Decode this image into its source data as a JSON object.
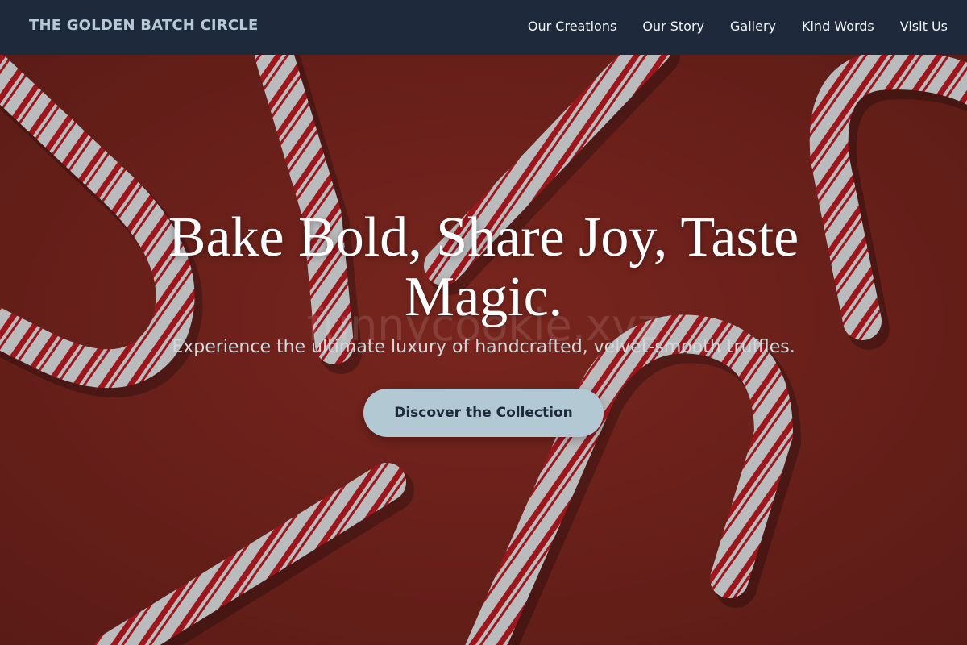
{
  "nav": {
    "brand": "THE GOLDEN BATCH CIRCLE",
    "links": [
      "Our Creations",
      "Our Story",
      "Gallery",
      "Kind Words",
      "Visit Us"
    ]
  },
  "hero": {
    "title": "Bake Bold, Share Joy, Taste Magic.",
    "subtitle": "Experience the ultimate luxury of handcrafted, velvet-smooth truffles.",
    "cta_label": "Discover the Collection",
    "watermark": "funnycookie.xyz",
    "background_image": "candy-canes-on-red"
  },
  "colors": {
    "nav_bg": "#1e293b",
    "brand": "#b6c9d4",
    "hero_bg": "#8a2419",
    "cta_bg": "#b2c9d3",
    "cta_text": "#1e293b"
  }
}
